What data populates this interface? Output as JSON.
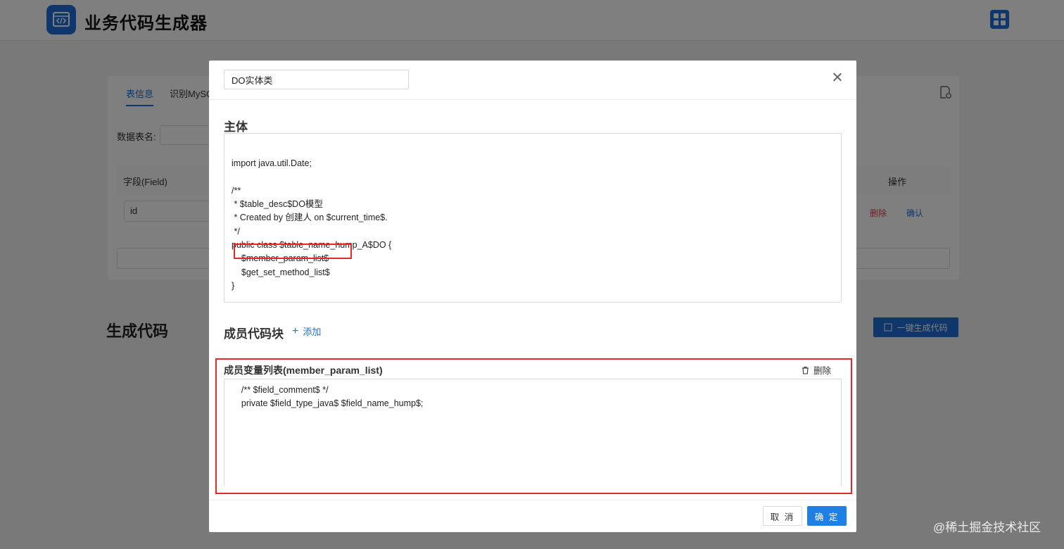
{
  "app": {
    "title": "业务代码生成器",
    "tabs": [
      "表信息",
      "识别MySC"
    ],
    "table_name_label": "数据表名:",
    "field_header": "字段(Field)",
    "op_header": "操作",
    "row_field": "id",
    "row_delete": "删除",
    "row_confirm": "确认",
    "gen_title": "生成代码",
    "gen_button": "一键生成代码"
  },
  "modal": {
    "title_value": "DO实体类",
    "main_title": "主体",
    "main_code": "\nimport java.util.Date;\n\n/**\n * $table_desc$DO模型\n * Created by 创建人 on $current_time$.\n */\npublic class $table_name_hump_A$DO {\n    $member_param_list$\n    $get_set_method_list$\n}",
    "members_title": "成员代码块",
    "add_label": "添加",
    "member": {
      "title": "成员变量列表(member_param_list)",
      "delete_label": "删除",
      "code": "    /** $field_comment$ */\n    private $field_type_java$ $field_name_hump$;"
    },
    "cancel_label": "取 消",
    "ok_label": "确 定"
  },
  "watermark": "@稀土掘金技术社区",
  "colors": {
    "primary": "#1f6fd6",
    "highlight_border": "#e3292c",
    "danger": "#e04040"
  }
}
